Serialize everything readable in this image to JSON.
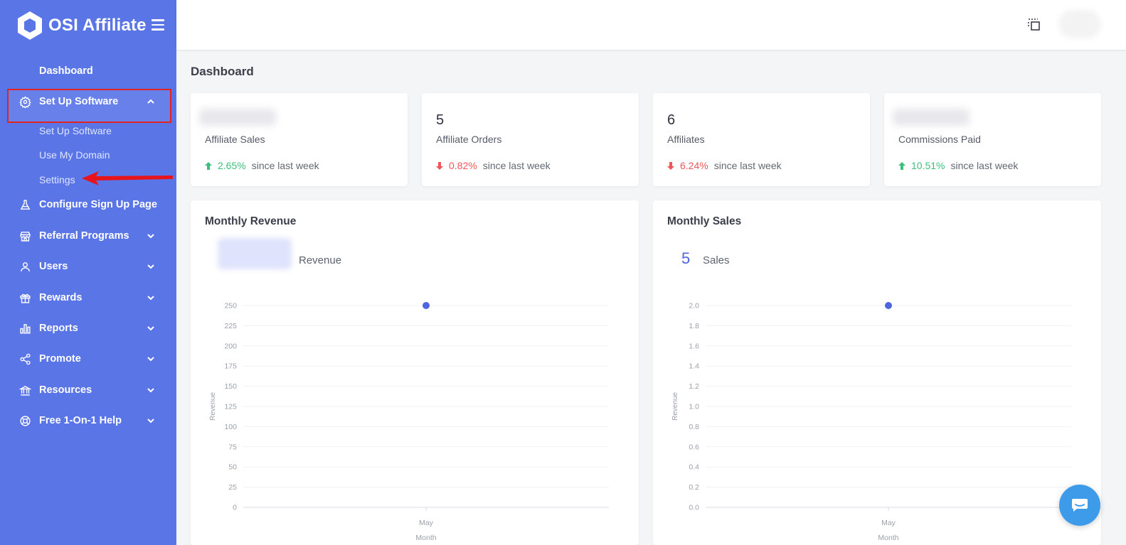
{
  "brand": {
    "name": "OSI Affiliate",
    "logo_icon": "hexagon-logo-icon"
  },
  "sidebar": {
    "items": [
      {
        "label": "Dashboard",
        "icon": "",
        "chevron": ""
      },
      {
        "label": "Set Up Software",
        "icon": "gear-icon",
        "chevron": "up",
        "active": true,
        "children": [
          "Set Up Software",
          "Use My Domain",
          "Settings"
        ]
      },
      {
        "label": "Configure Sign Up Page",
        "icon": "flask-icon",
        "chevron": ""
      },
      {
        "label": "Referral Programs",
        "icon": "store-icon",
        "chevron": "down"
      },
      {
        "label": "Users",
        "icon": "user-icon",
        "chevron": "down"
      },
      {
        "label": "Rewards",
        "icon": "gift-icon",
        "chevron": "down"
      },
      {
        "label": "Reports",
        "icon": "bar-chart-icon",
        "chevron": "down"
      },
      {
        "label": "Promote",
        "icon": "share-icon",
        "chevron": "down"
      },
      {
        "label": "Resources",
        "icon": "bank-icon",
        "chevron": "down"
      },
      {
        "label": "Free 1-On-1 Help",
        "icon": "lifebuoy-icon",
        "chevron": "down"
      }
    ]
  },
  "page": {
    "title": "Dashboard"
  },
  "stats": [
    {
      "value": "",
      "label": "Affiliate Sales",
      "trend": "up",
      "pct": "2.65%",
      "since": "since last week",
      "blurred": true
    },
    {
      "value": "5",
      "label": "Affiliate Orders",
      "trend": "down",
      "pct": "0.82%",
      "since": "since last week"
    },
    {
      "value": "6",
      "label": "Affiliates",
      "trend": "down",
      "pct": "6.24%",
      "since": "since last week"
    },
    {
      "value": "",
      "label": "Commissions Paid",
      "trend": "up",
      "pct": "10.51%",
      "since": "since last week",
      "blurred": true
    }
  ],
  "colors": {
    "sidebar": "#5a75e6",
    "accent": "#4d65e0",
    "up": "#3cbf7d",
    "down": "#f0555a"
  },
  "chart_data": [
    {
      "type": "scatter",
      "title": "Monthly Revenue",
      "summary_value": "",
      "summary_label": "Revenue",
      "xlabel": "Month",
      "ylabel": "Revenue",
      "x": [
        "May"
      ],
      "values": [
        250
      ],
      "ylim": [
        0,
        250
      ],
      "yticks": [
        "250",
        "225",
        "200",
        "175",
        "150",
        "125",
        "100",
        "75",
        "50",
        "25",
        "0"
      ],
      "grid": true
    },
    {
      "type": "scatter",
      "title": "Monthly Sales",
      "summary_value": "5",
      "summary_label": "Sales",
      "xlabel": "Month",
      "ylabel": "Revenue",
      "x": [
        "May"
      ],
      "values": [
        2.0
      ],
      "ylim": [
        0,
        2.0
      ],
      "yticks": [
        "2.0",
        "1.8",
        "1.6",
        "1.4",
        "1.2",
        "1.0",
        "0.8",
        "0.6",
        "0.4",
        "0.2",
        "0.0"
      ],
      "grid": true
    }
  ]
}
